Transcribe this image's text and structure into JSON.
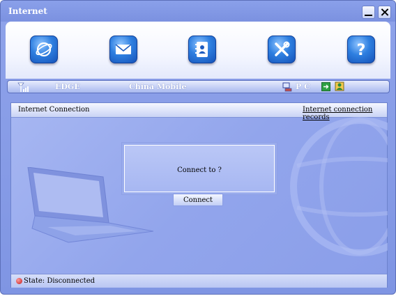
{
  "window": {
    "title": "Internet"
  },
  "toolbar": {
    "buttons": [
      {
        "icon": "internet-globe-icon"
      },
      {
        "icon": "envelope-icon"
      },
      {
        "icon": "contacts-book-icon"
      },
      {
        "icon": "tools-icon"
      },
      {
        "icon": "help-question-icon"
      }
    ]
  },
  "status": {
    "network": "EDGE",
    "operator": "China Mobile",
    "mode": "P C"
  },
  "panel": {
    "title": "Internet Connection",
    "records_link": "Internet connection records",
    "message": "Connect to ?",
    "connect_label": "Connect",
    "state": "State: Disconnected"
  }
}
